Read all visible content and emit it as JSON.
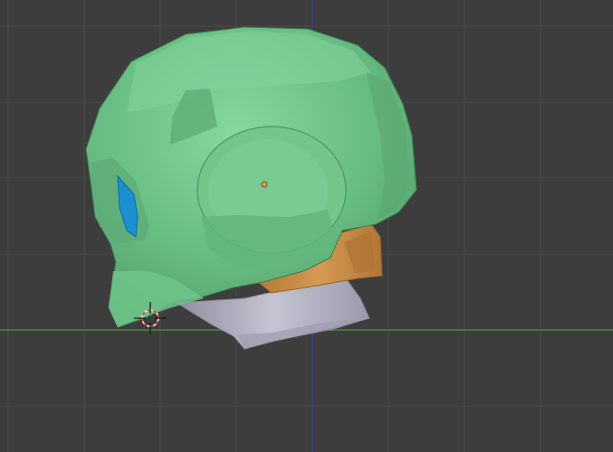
{
  "viewport": {
    "view": "3d-viewport",
    "background_color": "#3d3d3d",
    "grid_color": "#4a4a4a",
    "axis_x_color": "#5a8a3a",
    "axis_z_color": "#3a3aa0"
  },
  "object": {
    "name": "",
    "materials": [
      {
        "part": "helmet-shell",
        "color": "#6cc28a"
      },
      {
        "part": "visor",
        "color": "#1a8fd0"
      },
      {
        "part": "neck-ring",
        "color": "#c88a42"
      },
      {
        "part": "neck-base",
        "color": "#a4a4b4"
      }
    ]
  },
  "cursor": {
    "icon": "3d-cursor-icon",
    "colors": [
      "#e04040",
      "#ffffff"
    ]
  },
  "origin": {
    "icon": "object-origin-icon",
    "color": "#e8a050"
  }
}
